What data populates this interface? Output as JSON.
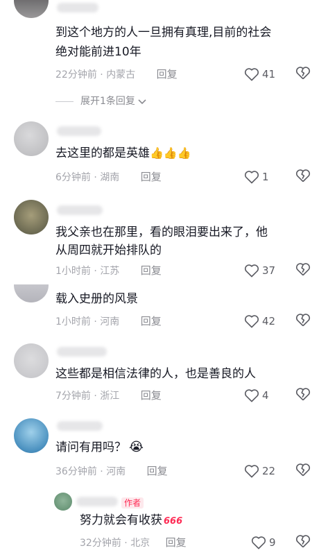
{
  "comments": [
    {
      "text_lines": [
        "到这个地方的人一旦拥有真理,目前的社会",
        "绝对能前进10年"
      ],
      "time": "22分钟前",
      "location": "内蒙古",
      "reply_label": "回复",
      "likes": "41",
      "expand_label": "展开1条回复"
    },
    {
      "text": "去这里的都是英雄",
      "emoji": "👍👍👍",
      "time": "6分钟前",
      "location": "湖南",
      "reply_label": "回复",
      "likes": "1"
    },
    {
      "text_lines": [
        "我父亲也在那里，看的眼泪要出来了，他",
        "从周四就开始排队的"
      ],
      "time": "1小时前",
      "location": "江苏",
      "reply_label": "回复",
      "likes": "37"
    },
    {
      "text": "载入史册的风景",
      "time": "1小时前",
      "location": "河南",
      "reply_label": "回复",
      "likes": "42"
    },
    {
      "text": "这些都是相信法律的人，也是善良的人",
      "time": "7分钟前",
      "location": "浙江",
      "reply_label": "回复",
      "likes": "4"
    },
    {
      "text": "请问有用吗？",
      "emoji": "😭",
      "time": "36分钟前",
      "location": "河南",
      "reply_label": "回复",
      "likes": "22"
    }
  ],
  "reply": {
    "badge": "作者",
    "text": "努力就会有收获",
    "sticker": "666",
    "time": "32分钟前",
    "location": "北京",
    "reply_label": "回复",
    "likes": "9"
  },
  "colors": {
    "meta": "#a3a4ab",
    "accent": "#fe2c55",
    "like_icon": "#5b5c63"
  },
  "icons": {
    "like": "heart-outline-icon",
    "dislike": "broken-heart-icon",
    "expand": "chevron-down-icon"
  }
}
